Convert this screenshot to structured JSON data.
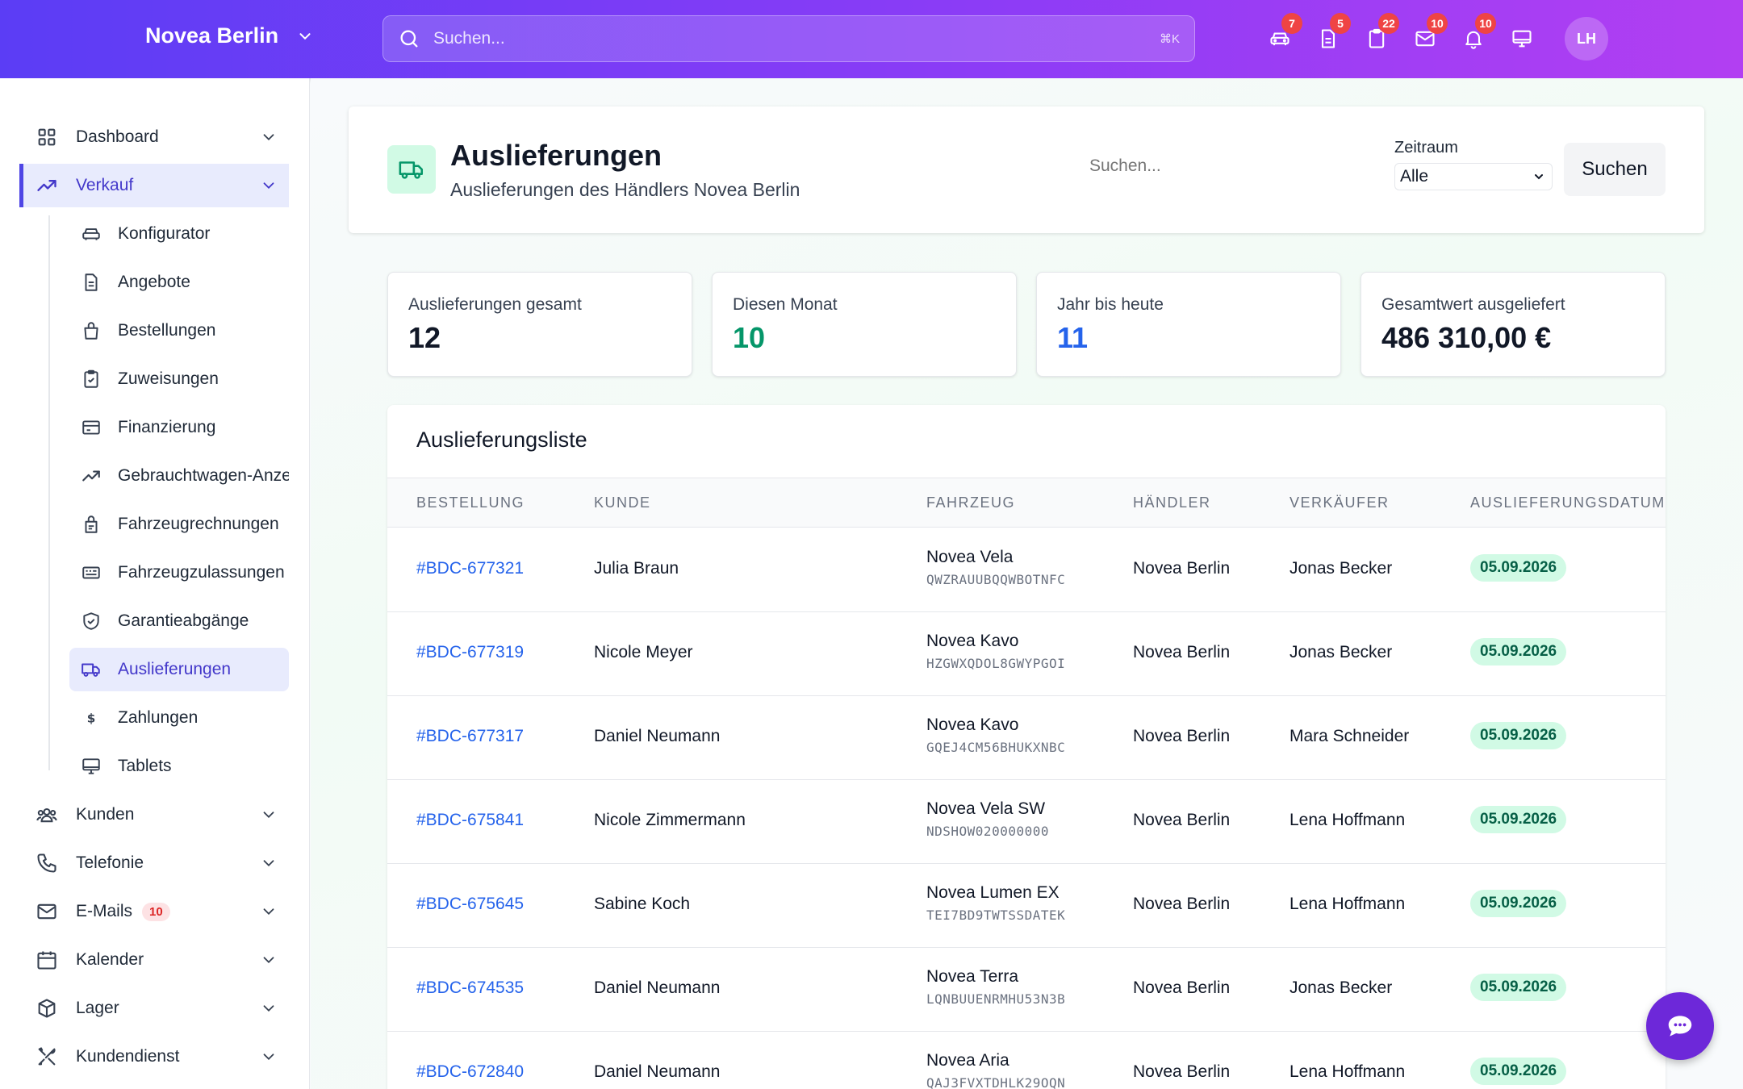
{
  "topbar": {
    "brand": "Novea Berlin",
    "search_placeholder": "Suchen...",
    "search_shortcut": "⌘K",
    "icons": [
      {
        "name": "car-icon",
        "badge": "7"
      },
      {
        "name": "document-icon",
        "badge": "5"
      },
      {
        "name": "clipboard-icon",
        "badge": "22"
      },
      {
        "name": "mail-icon",
        "badge": "10"
      },
      {
        "name": "bell-icon",
        "badge": "10"
      },
      {
        "name": "monitor-icon",
        "badge": ""
      }
    ],
    "avatar_initials": "LH"
  },
  "sidebar": {
    "items": [
      {
        "label": "Dashboard",
        "icon": "grid-icon"
      },
      {
        "label": "Verkauf",
        "icon": "trending-up-icon",
        "active": true
      },
      {
        "label": "Kunden",
        "icon": "users-icon"
      },
      {
        "label": "Telefonie",
        "icon": "phone-icon"
      },
      {
        "label": "E-Mails",
        "icon": "mail-icon",
        "badge": "10"
      },
      {
        "label": "Kalender",
        "icon": "calendar-icon"
      },
      {
        "label": "Lager",
        "icon": "box-icon"
      },
      {
        "label": "Kundendienst",
        "icon": "tools-icon"
      }
    ],
    "sub_items": [
      {
        "label": "Konfigurator",
        "icon": "car-icon"
      },
      {
        "label": "Angebote",
        "icon": "document-icon"
      },
      {
        "label": "Bestellungen",
        "icon": "bag-icon"
      },
      {
        "label": "Zuweisungen",
        "icon": "clipboard-check-icon"
      },
      {
        "label": "Finanzierung",
        "icon": "credit-card-icon"
      },
      {
        "label": "Gebrauchtwagen-Anzeigen",
        "icon": "trending-up-icon"
      },
      {
        "label": "Fahrzeugrechnungen",
        "icon": "receipt-icon"
      },
      {
        "label": "Fahrzeugzulassungen",
        "icon": "id-card-icon"
      },
      {
        "label": "Garantieabgänge",
        "icon": "shield-check-icon"
      },
      {
        "label": "Auslieferungen",
        "icon": "truck-icon",
        "active": true
      },
      {
        "label": "Zahlungen",
        "icon": "dollar-icon"
      },
      {
        "label": "Tablets",
        "icon": "monitor-icon"
      }
    ]
  },
  "header": {
    "title": "Auslieferungen",
    "subtitle": "Auslieferungen des Händlers Novea Berlin",
    "search_placeholder": "Suchen...",
    "period_label": "Zeitraum",
    "period_value": "Alle",
    "search_button": "Suchen"
  },
  "stats": [
    {
      "label": "Auslieferungen gesamt",
      "value": "12",
      "color": "#111827"
    },
    {
      "label": "Diesen Monat",
      "value": "10",
      "color": "#059669"
    },
    {
      "label": "Jahr bis heute",
      "value": "11",
      "color": "#2563eb"
    },
    {
      "label": "Gesamtwert ausgeliefert",
      "value": "486 310,00 €",
      "color": "#111827"
    }
  ],
  "table": {
    "title": "Auslieferungsliste",
    "columns": [
      "BESTELLUNG",
      "KUNDE",
      "FAHRZEUG",
      "HÄNDLER",
      "VERKÄUFER",
      "AUSLIEFERUNGSDATUM"
    ],
    "rows": [
      {
        "order": "#BDC-677321",
        "customer": "Julia Braun",
        "vehicle": "Novea Vela",
        "vin": "QWZRAUUBQQWBOTNFC",
        "dealer": "Novea Berlin",
        "seller": "Jonas Becker",
        "date": "05.09.2026"
      },
      {
        "order": "#BDC-677319",
        "customer": "Nicole Meyer",
        "vehicle": "Novea Kavo",
        "vin": "HZGWXQDOL8GWYPGOI",
        "dealer": "Novea Berlin",
        "seller": "Jonas Becker",
        "date": "05.09.2026"
      },
      {
        "order": "#BDC-677317",
        "customer": "Daniel Neumann",
        "vehicle": "Novea Kavo",
        "vin": "GQEJ4CM56BHUKXNBC",
        "dealer": "Novea Berlin",
        "seller": "Mara Schneider",
        "date": "05.09.2026"
      },
      {
        "order": "#BDC-675841",
        "customer": "Nicole Zimmermann",
        "vehicle": "Novea Vela SW",
        "vin": "NDSHOW020000000",
        "dealer": "Novea Berlin",
        "seller": "Lena Hoffmann",
        "date": "05.09.2026"
      },
      {
        "order": "#BDC-675645",
        "customer": "Sabine Koch",
        "vehicle": "Novea Lumen EX",
        "vin": "TEI7BD9TWTSSDATEK",
        "dealer": "Novea Berlin",
        "seller": "Lena Hoffmann",
        "date": "05.09.2026"
      },
      {
        "order": "#BDC-674535",
        "customer": "Daniel Neumann",
        "vehicle": "Novea Terra",
        "vin": "LQNBUUENRMHU53N3B",
        "dealer": "Novea Berlin",
        "seller": "Jonas Becker",
        "date": "05.09.2026"
      },
      {
        "order": "#BDC-672840",
        "customer": "Daniel Neumann",
        "vehicle": "Novea Aria",
        "vin": "QAJ3FVXTDHLK29OQN",
        "dealer": "Novea Berlin",
        "seller": "Lena Hoffmann",
        "date": "05.09.2026"
      }
    ]
  },
  "chat_button": {
    "icon": "chat-icon"
  }
}
